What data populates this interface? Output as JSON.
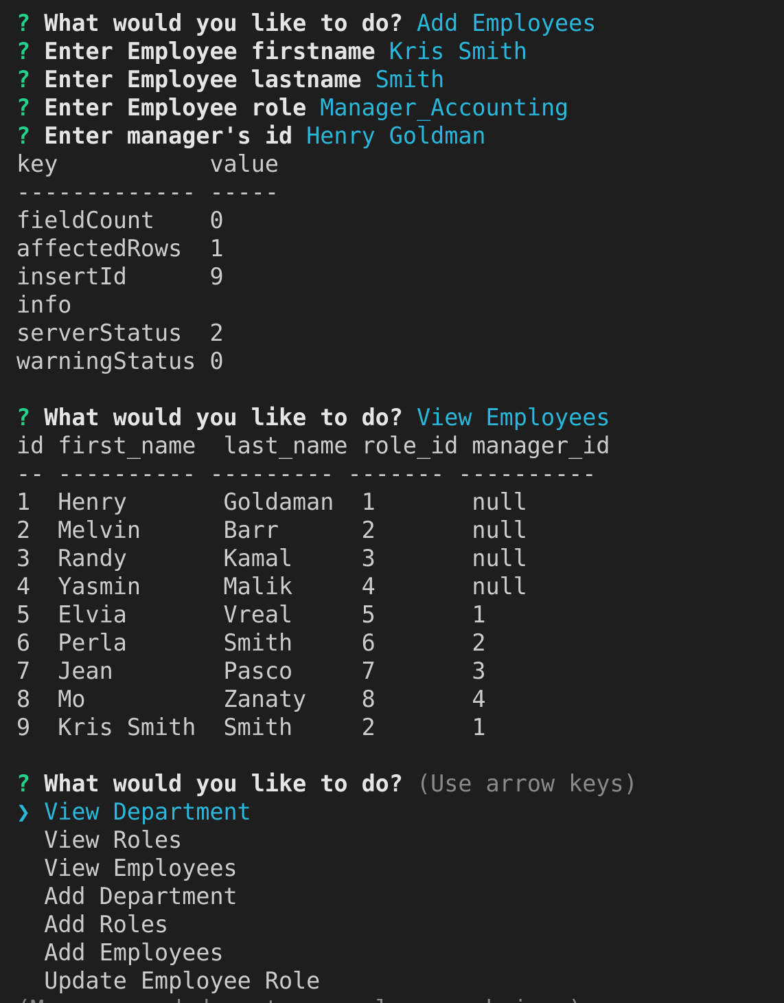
{
  "colors": {
    "background": "#1e1e1e",
    "text": "#cccccc",
    "prompt_mark": "#23d18b",
    "answer": "#29b8db",
    "hint": "#8a8a8a"
  },
  "prompts": [
    {
      "mark": "?",
      "message": "What would you like to do?",
      "answer": "Add Employees"
    },
    {
      "mark": "?",
      "message": "Enter Employee firstname",
      "answer": "Kris Smith"
    },
    {
      "mark": "?",
      "message": "Enter Employee lastname",
      "answer": "Smith"
    },
    {
      "mark": "?",
      "message": "Enter Employee role",
      "answer": "Manager_Accounting"
    },
    {
      "mark": "?",
      "message": "Enter manager's id",
      "answer": "Henry Goldman"
    }
  ],
  "result_table": {
    "header": "key           value",
    "divider": "------------- -----",
    "rows": [
      "fieldCount    0",
      "affectedRows  1",
      "insertId      9",
      "info",
      "serverStatus  2",
      "warningStatus 0"
    ]
  },
  "prompt2": {
    "mark": "?",
    "message": "What would you like to do?",
    "answer": "View Employees"
  },
  "employee_table": {
    "header": "id first_name  last_name role_id manager_id",
    "divider": "-- ---------- --------- ------- ----------",
    "rows": [
      "1  Henry       Goldaman  1       null",
      "2  Melvin      Barr      2       null",
      "3  Randy       Kamal     3       null",
      "4  Yasmin      Malik     4       null",
      "5  Elvia       Vreal     5       1",
      "6  Perla       Smith     6       2",
      "7  Jean        Pasco     7       3",
      "8  Mo          Zanaty    8       4",
      "9  Kris Smith  Smith     2       1"
    ]
  },
  "prompt3": {
    "mark": "?",
    "message": "What would you like to do?",
    "hint": "(Use arrow keys)"
  },
  "menu": {
    "pointer": "❯",
    "selected": "View Department",
    "options": [
      "View Roles",
      "View Employees",
      "Add Department",
      "Add Roles",
      "Add Employees",
      "Update Employee Role"
    ],
    "footer_hint": "(Move up and down to reveal more choices)"
  }
}
